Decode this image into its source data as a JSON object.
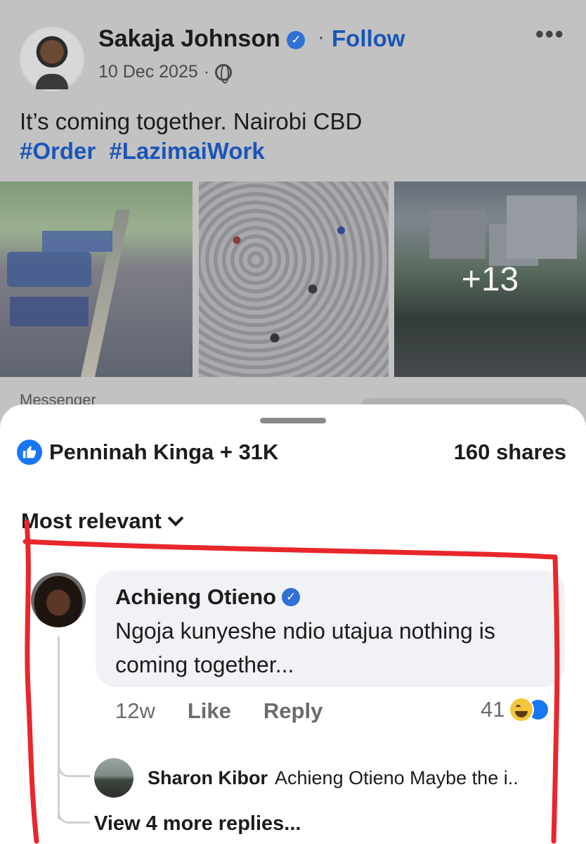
{
  "post": {
    "author": "Sakaja Johnson",
    "follow_label": "Follow",
    "date": "10 Dec 2025",
    "date_separator": "·",
    "text": "It’s coming together. Nairobi CBD",
    "hashtags": [
      "#Order",
      "#LazimaiWork"
    ],
    "photos_extra_count": "+13",
    "more_label": "•••",
    "peek_label": "Messenger"
  },
  "sheet": {
    "reactions_summary": "Penninah Kinga + 31K",
    "shares": "160 shares",
    "sort_label": "Most relevant"
  },
  "comment": {
    "author": "Achieng Otieno",
    "text": "Ngoja kunyeshe ndio utajua nothing is coming together...",
    "time": "12w",
    "like_label": "Like",
    "reply_label": "Reply",
    "reaction_count": "41"
  },
  "reply": {
    "author": "Sharon Kibor",
    "text": "Achieng Otieno Maybe the i..",
    "view_more": "View 4 more replies..."
  },
  "colors": {
    "brand_blue": "#1877f2",
    "link_blue": "#1a55b8",
    "annotation_red": "#e8262b"
  }
}
